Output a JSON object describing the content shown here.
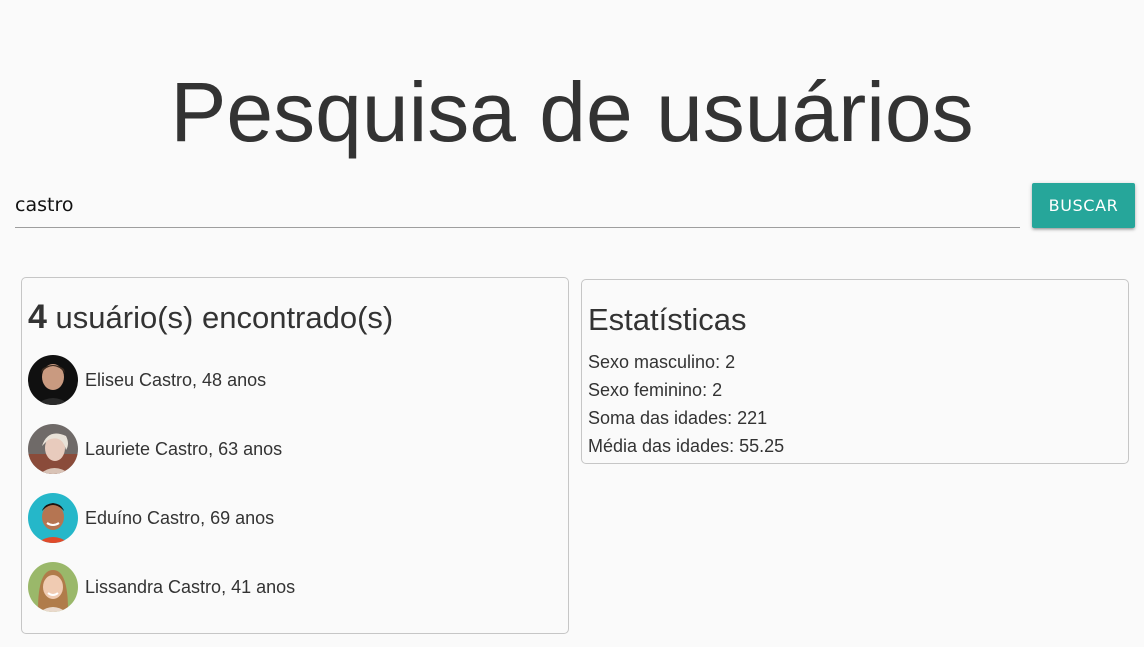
{
  "header": {
    "title": "Pesquisa de usuários"
  },
  "search": {
    "value": "castro",
    "button_label": "BUSCAR"
  },
  "results": {
    "count": "4",
    "label": "usuário(s) encontrado(s)",
    "users": [
      {
        "name": "Eliseu Castro, 48 anos"
      },
      {
        "name": "Lauriete Castro, 63 anos"
      },
      {
        "name": "Eduíno Castro, 69 anos"
      },
      {
        "name": "Lissandra Castro, 41 anos"
      }
    ]
  },
  "statistics": {
    "title": "Estatísticas",
    "male": "Sexo masculino: 2",
    "female": "Sexo feminino: 2",
    "age_sum": "Soma das idades: 221",
    "age_avg": "Média das idades: 55.25"
  },
  "colors": {
    "accent": "#26a69a",
    "text": "#333333",
    "background": "#fafafa"
  }
}
